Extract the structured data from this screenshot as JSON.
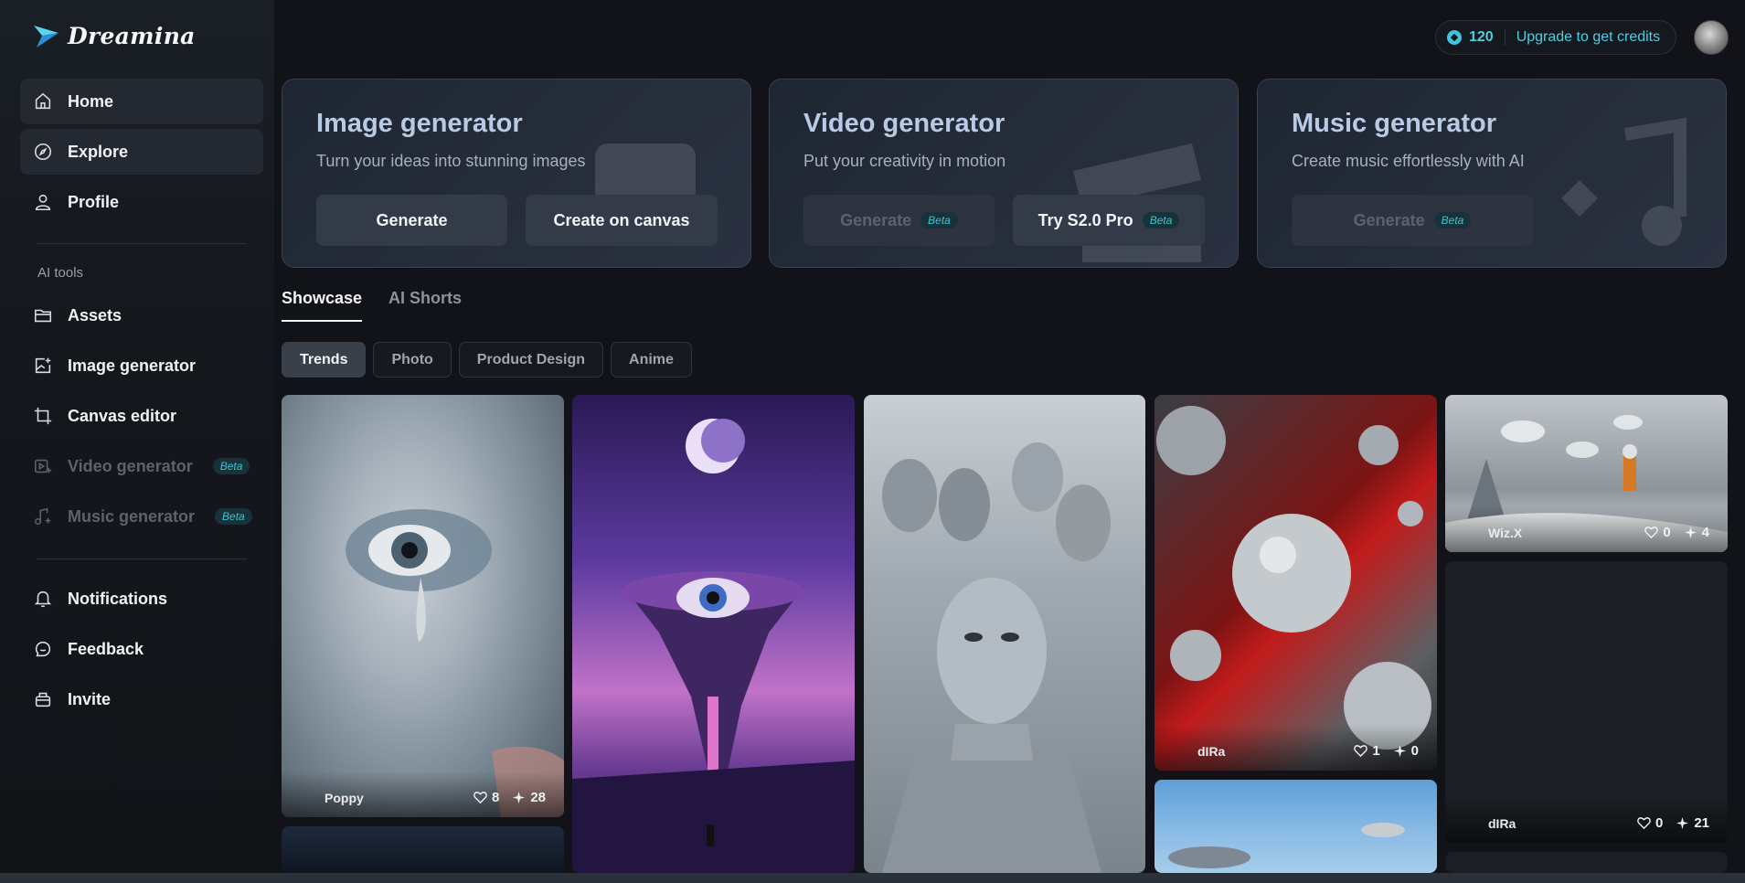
{
  "app": {
    "name": "Dreamina"
  },
  "header": {
    "credits": "120",
    "upgrade_label": "Upgrade to get credits"
  },
  "sidebar": {
    "primary": [
      {
        "label": "Home",
        "icon": "home-icon"
      },
      {
        "label": "Explore",
        "icon": "compass-icon"
      },
      {
        "label": "Profile",
        "icon": "user-icon"
      }
    ],
    "section_label": "AI tools",
    "tools": [
      {
        "label": "Assets",
        "icon": "folder-icon"
      },
      {
        "label": "Image generator",
        "icon": "image-plus-icon"
      },
      {
        "label": "Canvas editor",
        "icon": "crop-icon"
      },
      {
        "label": "Video generator",
        "icon": "video-plus-icon",
        "badge": "Beta"
      },
      {
        "label": "Music generator",
        "icon": "music-plus-icon",
        "badge": "Beta"
      }
    ],
    "secondary": [
      {
        "label": "Notifications",
        "icon": "bell-icon"
      },
      {
        "label": "Feedback",
        "icon": "chat-icon"
      },
      {
        "label": "Invite",
        "icon": "gift-icon"
      }
    ]
  },
  "generators": [
    {
      "title": "Image generator",
      "subtitle": "Turn your ideas into stunning images",
      "buttons": [
        {
          "label": "Generate"
        },
        {
          "label": "Create on canvas"
        }
      ]
    },
    {
      "title": "Video generator",
      "subtitle": "Put your creativity in motion",
      "buttons": [
        {
          "label": "Generate",
          "badge": "Beta"
        },
        {
          "label": "Try S2.0 Pro",
          "badge": "Beta"
        }
      ]
    },
    {
      "title": "Music generator",
      "subtitle": "Create music effortlessly with AI",
      "buttons": [
        {
          "label": "Generate",
          "badge": "Beta"
        }
      ]
    }
  ],
  "tabs": [
    "Showcase",
    "AI Shorts"
  ],
  "filters": [
    "Trends",
    "Photo",
    "Product Design",
    "Anime"
  ],
  "gallery": [
    {
      "author": "Poppy",
      "likes": "8",
      "remixes": "28"
    },
    {
      "author": "Wiz.X",
      "likes": "0",
      "remixes": "4"
    },
    {
      "author": "dIRa",
      "likes": "1",
      "remixes": "0"
    },
    {
      "author": "dIRa",
      "likes": "0",
      "remixes": "21"
    }
  ]
}
